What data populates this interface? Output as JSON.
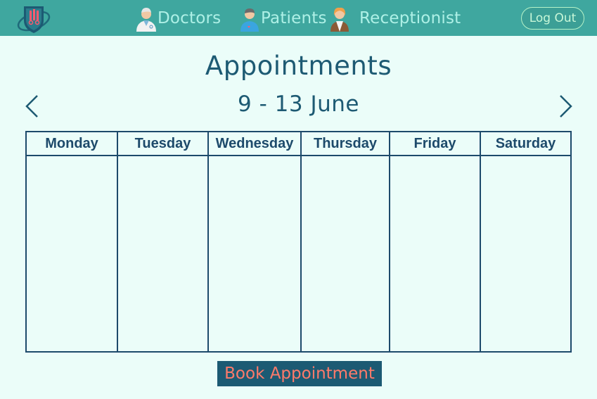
{
  "nav": {
    "logo": "hospital-logo",
    "items": [
      {
        "label": "Doctors",
        "icon": "doctor-avatar-icon"
      },
      {
        "label": "Patients",
        "icon": "patient-avatar-icon"
      },
      {
        "label": "Receptionist",
        "icon": "receptionist-avatar-icon"
      }
    ],
    "logout_label": "Log Out"
  },
  "page": {
    "title": "Appointments",
    "week_range": "9 - 13 June",
    "prev_icon": "chevron-left-icon",
    "next_icon": "chevron-right-icon"
  },
  "calendar": {
    "days": [
      "Monday",
      "Tuesday",
      "Wednesday",
      "Thursday",
      "Friday",
      "Saturday"
    ]
  },
  "actions": {
    "book_label": "Book Appointment"
  },
  "colors": {
    "header_bg": "#3fa79f",
    "page_bg": "#ebfdf9",
    "primary_text": "#1d5a73",
    "book_button_bg": "#1c5a73",
    "book_button_text": "#ff7a6a"
  }
}
